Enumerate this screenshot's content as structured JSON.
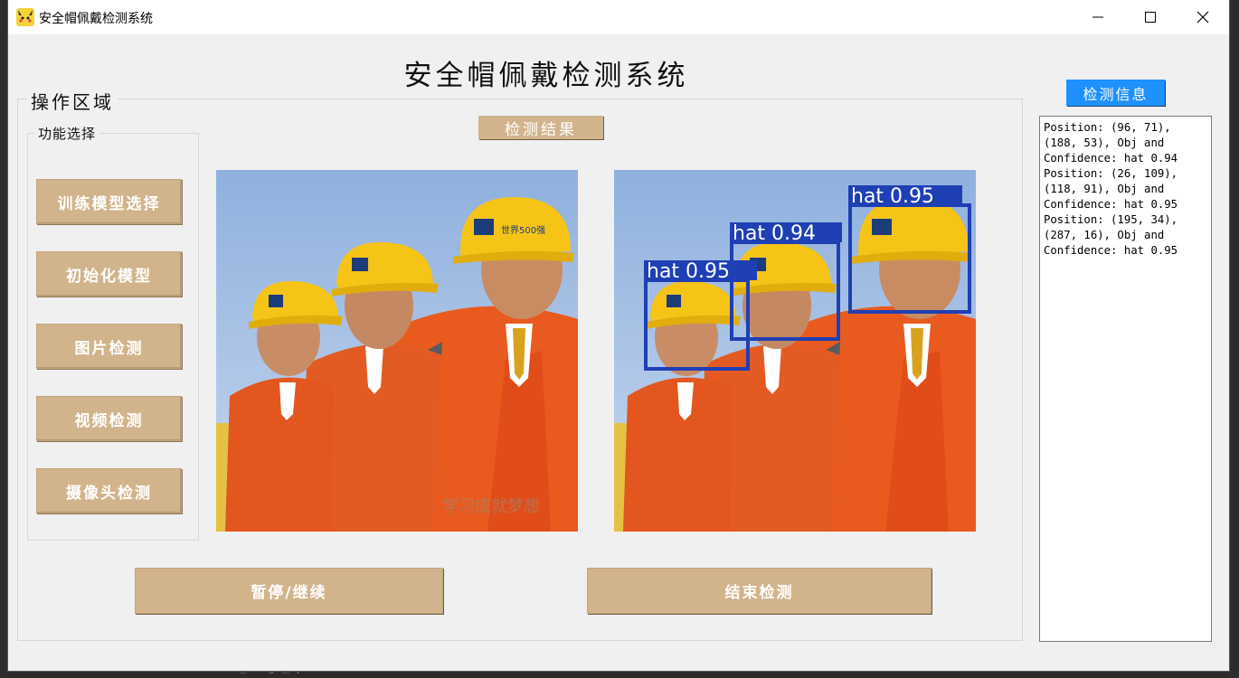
{
  "window": {
    "title": "安全帽佩戴检测系统"
  },
  "main_title": "安全帽佩戴检测系统",
  "operation_area": {
    "title": "操作区域",
    "function_group_title": "功能选择",
    "buttons": [
      "训练模型选择",
      "初始化模型",
      "图片检测",
      "视频检测",
      "摄像头检测"
    ]
  },
  "result_label": "检测结果",
  "bottom_buttons": {
    "pause": "暂停/继续",
    "stop": "结束检测"
  },
  "info": {
    "button": "检测信息",
    "lines": [
      "Position: (96, 71),",
      "(188, 53), Obj and",
      "Confidence: hat 0.94",
      "Position: (26, 109),",
      "(118, 91), Obj and",
      "Confidence: hat 0.95",
      "Position: (195, 34),",
      "(287, 16), Obj and",
      "Confidence: hat 0.95"
    ]
  },
  "detections": [
    {
      "label": "hat 0.95"
    },
    {
      "label": "hat 0.94"
    },
    {
      "label": "hat 0.95"
    }
  ],
  "photo_watermark": "学习成就梦想",
  "helmet_logo_text": "世界500强",
  "background_text": "button_image_open",
  "colors": {
    "button": "#d1b48c",
    "info_button": "#1e90ff",
    "box": "#1f3fb4"
  }
}
